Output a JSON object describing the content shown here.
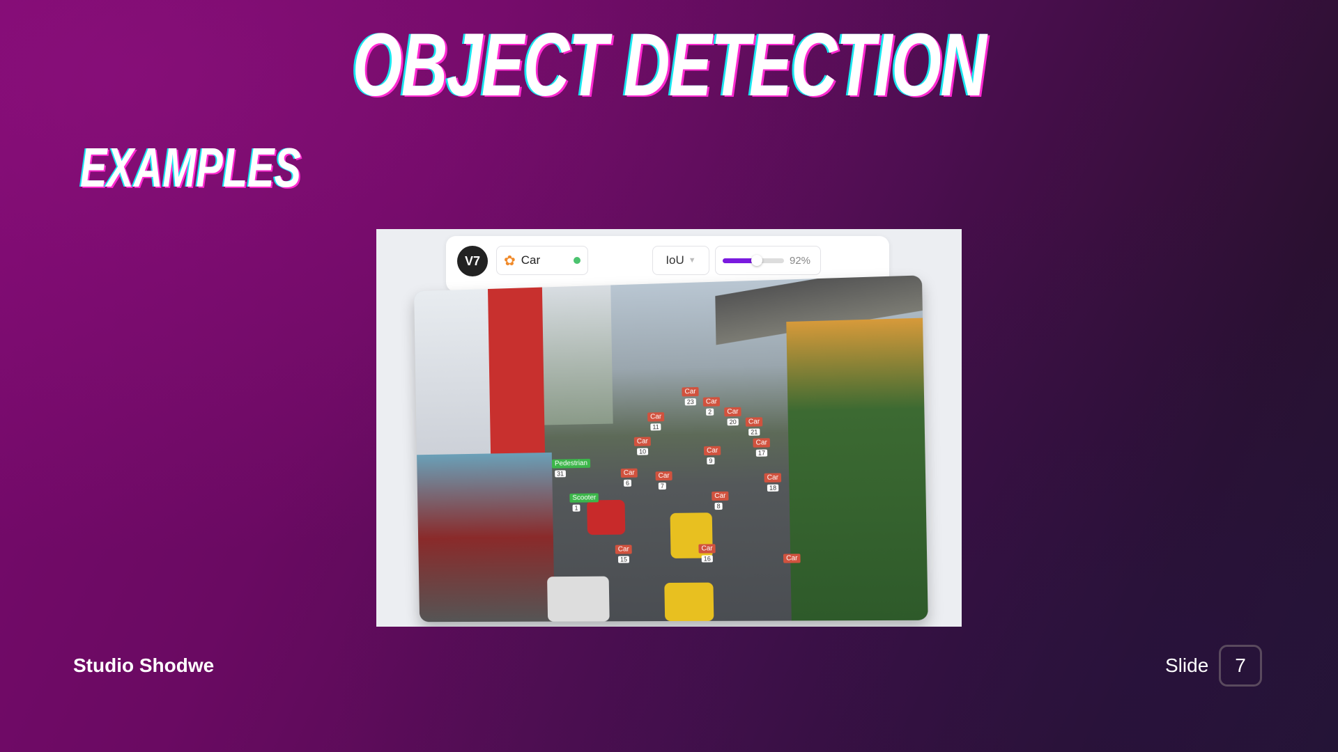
{
  "slide": {
    "title": "OBJECT DETECTION",
    "subtitle": "EXAMPLES",
    "brand": "Studio Shodwe",
    "slide_label": "Slide",
    "slide_number": "7"
  },
  "toolbar": {
    "logo": "V7",
    "class_label": "Car",
    "class_icon": "polygon-icon",
    "status_color": "#4cc36f",
    "metric": "IoU",
    "threshold_percent": 92,
    "threshold_label": "92%",
    "accent": "#7a1adf"
  },
  "photo": {
    "labels": [
      {
        "text": "Car",
        "num": "23"
      },
      {
        "text": "Car",
        "num": "2"
      },
      {
        "text": "Car",
        "num": "20"
      },
      {
        "text": "Car",
        "num": "11"
      },
      {
        "text": "Car",
        "num": "21"
      },
      {
        "text": "Car",
        "num": "10"
      },
      {
        "text": "Car",
        "num": "9"
      },
      {
        "text": "Car",
        "num": "17"
      },
      {
        "text": "Pedestrian",
        "num": "31"
      },
      {
        "text": "Car",
        "num": "6"
      },
      {
        "text": "Car",
        "num": "7"
      },
      {
        "text": "Car",
        "num": "18"
      },
      {
        "text": "Scooter",
        "num": "1"
      },
      {
        "text": "Car",
        "num": "8"
      },
      {
        "text": "Car",
        "num": "15"
      },
      {
        "text": "Car",
        "num": "16"
      },
      {
        "text": "Car",
        "num": ""
      }
    ]
  }
}
